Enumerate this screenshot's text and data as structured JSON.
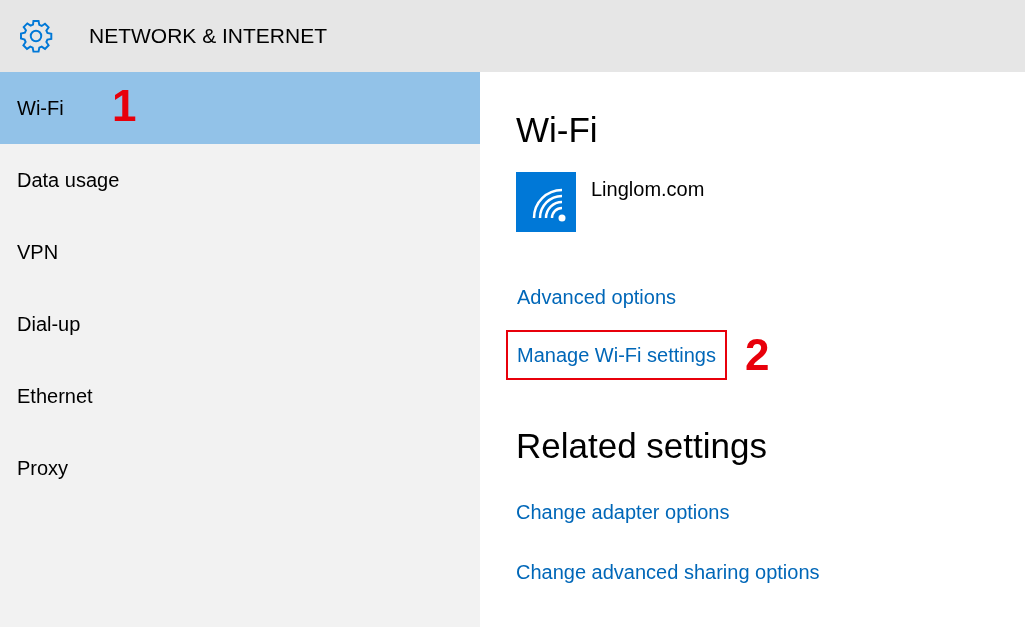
{
  "header": {
    "title": "NETWORK & INTERNET"
  },
  "sidebar": {
    "items": [
      {
        "label": "Wi-Fi",
        "selected": true,
        "annotation": "1"
      },
      {
        "label": "Data usage",
        "selected": false
      },
      {
        "label": "VPN",
        "selected": false
      },
      {
        "label": "Dial-up",
        "selected": false
      },
      {
        "label": "Ethernet",
        "selected": false
      },
      {
        "label": "Proxy",
        "selected": false
      }
    ]
  },
  "content": {
    "heading": "Wi-Fi",
    "network": {
      "name": "Linglom.com"
    },
    "links": [
      {
        "label": "Advanced options",
        "highlighted": false
      },
      {
        "label": "Manage Wi-Fi settings",
        "highlighted": true,
        "annotation": "2"
      }
    ],
    "related": {
      "heading": "Related settings",
      "links": [
        {
          "label": "Change adapter options"
        },
        {
          "label": "Change advanced sharing options"
        }
      ]
    }
  }
}
